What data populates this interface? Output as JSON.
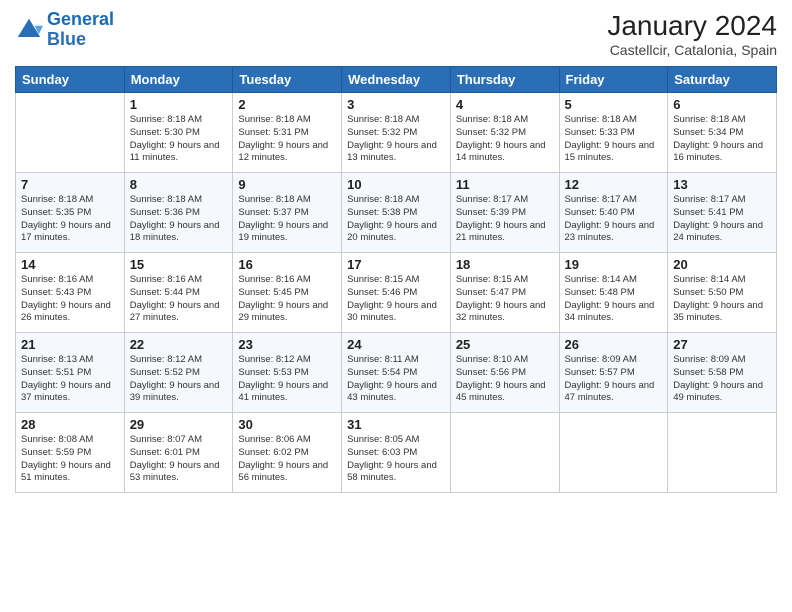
{
  "header": {
    "logo_line1": "General",
    "logo_line2": "Blue",
    "month_title": "January 2024",
    "location": "Castellcir, Catalonia, Spain"
  },
  "days_of_week": [
    "Sunday",
    "Monday",
    "Tuesday",
    "Wednesday",
    "Thursday",
    "Friday",
    "Saturday"
  ],
  "weeks": [
    [
      {
        "day": "",
        "sunrise": "",
        "sunset": "",
        "daylight": ""
      },
      {
        "day": "1",
        "sunrise": "Sunrise: 8:18 AM",
        "sunset": "Sunset: 5:30 PM",
        "daylight": "Daylight: 9 hours and 11 minutes."
      },
      {
        "day": "2",
        "sunrise": "Sunrise: 8:18 AM",
        "sunset": "Sunset: 5:31 PM",
        "daylight": "Daylight: 9 hours and 12 minutes."
      },
      {
        "day": "3",
        "sunrise": "Sunrise: 8:18 AM",
        "sunset": "Sunset: 5:32 PM",
        "daylight": "Daylight: 9 hours and 13 minutes."
      },
      {
        "day": "4",
        "sunrise": "Sunrise: 8:18 AM",
        "sunset": "Sunset: 5:32 PM",
        "daylight": "Daylight: 9 hours and 14 minutes."
      },
      {
        "day": "5",
        "sunrise": "Sunrise: 8:18 AM",
        "sunset": "Sunset: 5:33 PM",
        "daylight": "Daylight: 9 hours and 15 minutes."
      },
      {
        "day": "6",
        "sunrise": "Sunrise: 8:18 AM",
        "sunset": "Sunset: 5:34 PM",
        "daylight": "Daylight: 9 hours and 16 minutes."
      }
    ],
    [
      {
        "day": "7",
        "sunrise": "Sunrise: 8:18 AM",
        "sunset": "Sunset: 5:35 PM",
        "daylight": "Daylight: 9 hours and 17 minutes."
      },
      {
        "day": "8",
        "sunrise": "Sunrise: 8:18 AM",
        "sunset": "Sunset: 5:36 PM",
        "daylight": "Daylight: 9 hours and 18 minutes."
      },
      {
        "day": "9",
        "sunrise": "Sunrise: 8:18 AM",
        "sunset": "Sunset: 5:37 PM",
        "daylight": "Daylight: 9 hours and 19 minutes."
      },
      {
        "day": "10",
        "sunrise": "Sunrise: 8:18 AM",
        "sunset": "Sunset: 5:38 PM",
        "daylight": "Daylight: 9 hours and 20 minutes."
      },
      {
        "day": "11",
        "sunrise": "Sunrise: 8:17 AM",
        "sunset": "Sunset: 5:39 PM",
        "daylight": "Daylight: 9 hours and 21 minutes."
      },
      {
        "day": "12",
        "sunrise": "Sunrise: 8:17 AM",
        "sunset": "Sunset: 5:40 PM",
        "daylight": "Daylight: 9 hours and 23 minutes."
      },
      {
        "day": "13",
        "sunrise": "Sunrise: 8:17 AM",
        "sunset": "Sunset: 5:41 PM",
        "daylight": "Daylight: 9 hours and 24 minutes."
      }
    ],
    [
      {
        "day": "14",
        "sunrise": "Sunrise: 8:16 AM",
        "sunset": "Sunset: 5:43 PM",
        "daylight": "Daylight: 9 hours and 26 minutes."
      },
      {
        "day": "15",
        "sunrise": "Sunrise: 8:16 AM",
        "sunset": "Sunset: 5:44 PM",
        "daylight": "Daylight: 9 hours and 27 minutes."
      },
      {
        "day": "16",
        "sunrise": "Sunrise: 8:16 AM",
        "sunset": "Sunset: 5:45 PM",
        "daylight": "Daylight: 9 hours and 29 minutes."
      },
      {
        "day": "17",
        "sunrise": "Sunrise: 8:15 AM",
        "sunset": "Sunset: 5:46 PM",
        "daylight": "Daylight: 9 hours and 30 minutes."
      },
      {
        "day": "18",
        "sunrise": "Sunrise: 8:15 AM",
        "sunset": "Sunset: 5:47 PM",
        "daylight": "Daylight: 9 hours and 32 minutes."
      },
      {
        "day": "19",
        "sunrise": "Sunrise: 8:14 AM",
        "sunset": "Sunset: 5:48 PM",
        "daylight": "Daylight: 9 hours and 34 minutes."
      },
      {
        "day": "20",
        "sunrise": "Sunrise: 8:14 AM",
        "sunset": "Sunset: 5:50 PM",
        "daylight": "Daylight: 9 hours and 35 minutes."
      }
    ],
    [
      {
        "day": "21",
        "sunrise": "Sunrise: 8:13 AM",
        "sunset": "Sunset: 5:51 PM",
        "daylight": "Daylight: 9 hours and 37 minutes."
      },
      {
        "day": "22",
        "sunrise": "Sunrise: 8:12 AM",
        "sunset": "Sunset: 5:52 PM",
        "daylight": "Daylight: 9 hours and 39 minutes."
      },
      {
        "day": "23",
        "sunrise": "Sunrise: 8:12 AM",
        "sunset": "Sunset: 5:53 PM",
        "daylight": "Daylight: 9 hours and 41 minutes."
      },
      {
        "day": "24",
        "sunrise": "Sunrise: 8:11 AM",
        "sunset": "Sunset: 5:54 PM",
        "daylight": "Daylight: 9 hours and 43 minutes."
      },
      {
        "day": "25",
        "sunrise": "Sunrise: 8:10 AM",
        "sunset": "Sunset: 5:56 PM",
        "daylight": "Daylight: 9 hours and 45 minutes."
      },
      {
        "day": "26",
        "sunrise": "Sunrise: 8:09 AM",
        "sunset": "Sunset: 5:57 PM",
        "daylight": "Daylight: 9 hours and 47 minutes."
      },
      {
        "day": "27",
        "sunrise": "Sunrise: 8:09 AM",
        "sunset": "Sunset: 5:58 PM",
        "daylight": "Daylight: 9 hours and 49 minutes."
      }
    ],
    [
      {
        "day": "28",
        "sunrise": "Sunrise: 8:08 AM",
        "sunset": "Sunset: 5:59 PM",
        "daylight": "Daylight: 9 hours and 51 minutes."
      },
      {
        "day": "29",
        "sunrise": "Sunrise: 8:07 AM",
        "sunset": "Sunset: 6:01 PM",
        "daylight": "Daylight: 9 hours and 53 minutes."
      },
      {
        "day": "30",
        "sunrise": "Sunrise: 8:06 AM",
        "sunset": "Sunset: 6:02 PM",
        "daylight": "Daylight: 9 hours and 56 minutes."
      },
      {
        "day": "31",
        "sunrise": "Sunrise: 8:05 AM",
        "sunset": "Sunset: 6:03 PM",
        "daylight": "Daylight: 9 hours and 58 minutes."
      },
      {
        "day": "",
        "sunrise": "",
        "sunset": "",
        "daylight": ""
      },
      {
        "day": "",
        "sunrise": "",
        "sunset": "",
        "daylight": ""
      },
      {
        "day": "",
        "sunrise": "",
        "sunset": "",
        "daylight": ""
      }
    ]
  ]
}
